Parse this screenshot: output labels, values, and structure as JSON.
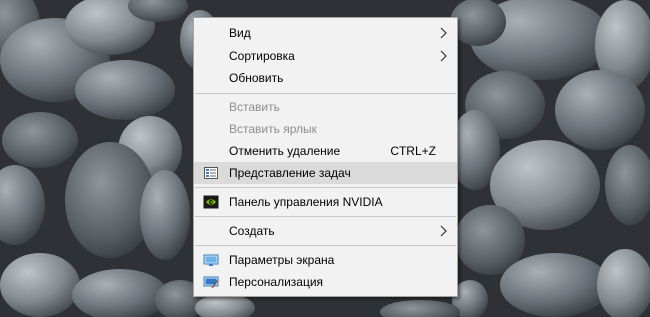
{
  "desktop": {
    "wallpaper": "pebble-stones"
  },
  "context_menu": {
    "items": [
      {
        "label": "Вид",
        "submenu": true
      },
      {
        "label": "Сортировка",
        "submenu": true
      },
      {
        "label": "Обновить"
      },
      {
        "label": "Вставить",
        "disabled": true
      },
      {
        "label": "Вставить ярлык",
        "disabled": true
      },
      {
        "label": "Отменить удаление",
        "shortcut": "CTRL+Z"
      },
      {
        "label": "Представление задач",
        "icon": "task-view-icon",
        "highlighted": true
      },
      {
        "label": "Панель управления NVIDIA",
        "icon": "nvidia-icon"
      },
      {
        "label": "Создать",
        "submenu": true
      },
      {
        "label": "Параметры экрана",
        "icon": "display-settings-icon"
      },
      {
        "label": "Персонализация",
        "icon": "personalization-icon"
      }
    ]
  },
  "colors": {
    "menu_background": "#f2f2f2",
    "highlight": "#dadada",
    "disabled_text": "#8d8d8d",
    "nvidia_green": "#76b900"
  }
}
